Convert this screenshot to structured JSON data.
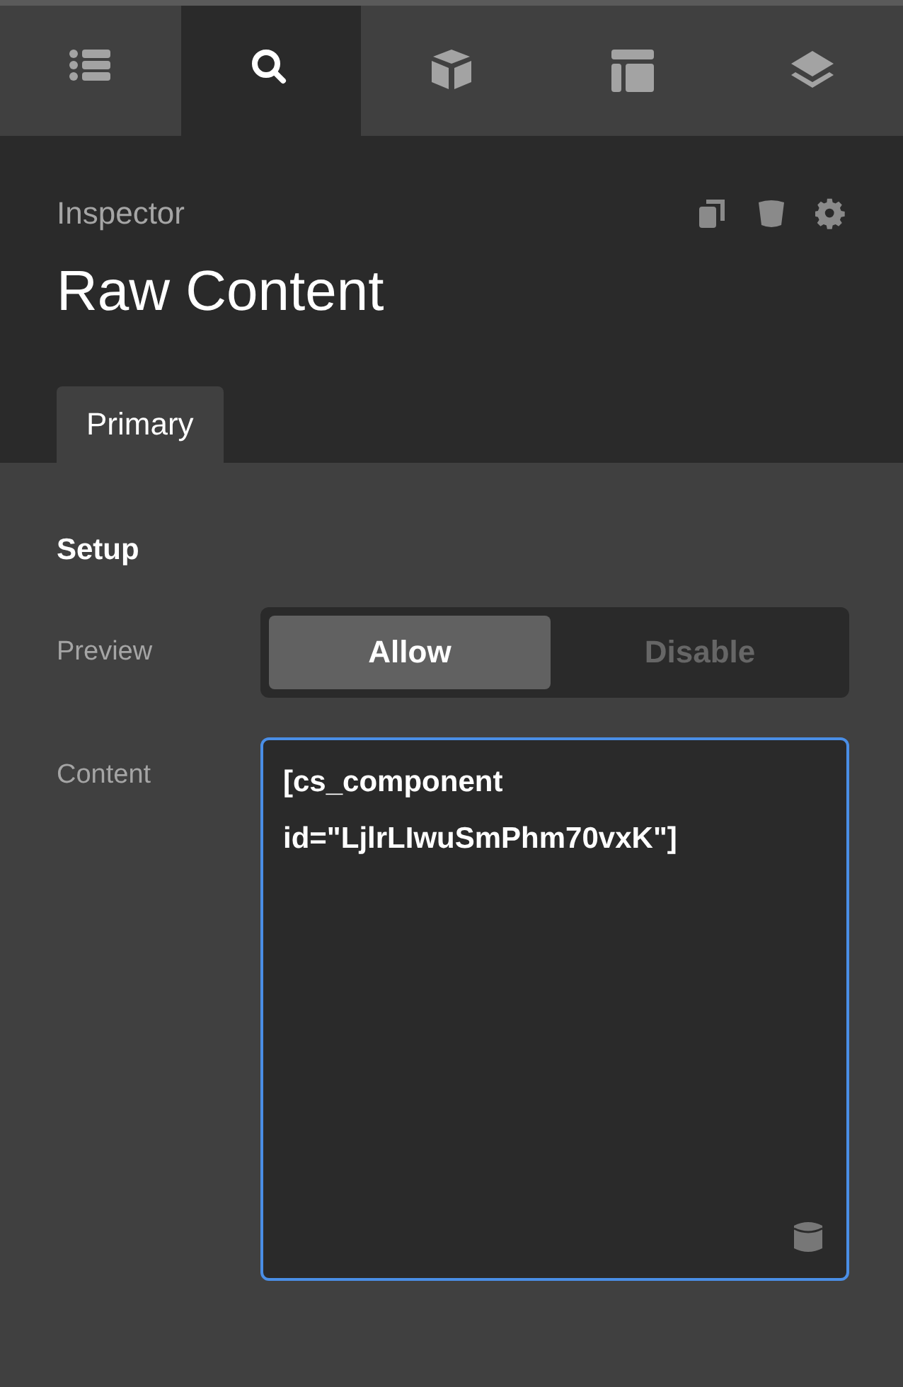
{
  "toolbar": [
    {
      "kind": "list",
      "selected": false
    },
    {
      "kind": "search",
      "selected": true
    },
    {
      "kind": "cube",
      "selected": false
    },
    {
      "kind": "layout",
      "selected": false
    },
    {
      "kind": "layers",
      "selected": false
    }
  ],
  "inspector": {
    "label": "Inspector",
    "title": "Raw Content"
  },
  "tabs": [
    {
      "label": "Primary",
      "selected": true
    }
  ],
  "section": {
    "title": "Setup"
  },
  "fields": [
    {
      "kind": "segmented",
      "label": "Preview",
      "options": [
        {
          "label": "Allow",
          "selected": true
        },
        {
          "label": "Disable",
          "selected": false
        }
      ]
    },
    {
      "kind": "textarea",
      "label": "Content",
      "value": "[cs_component id=\"LjlrLIwuSmPhm70vxK\"]"
    }
  ]
}
